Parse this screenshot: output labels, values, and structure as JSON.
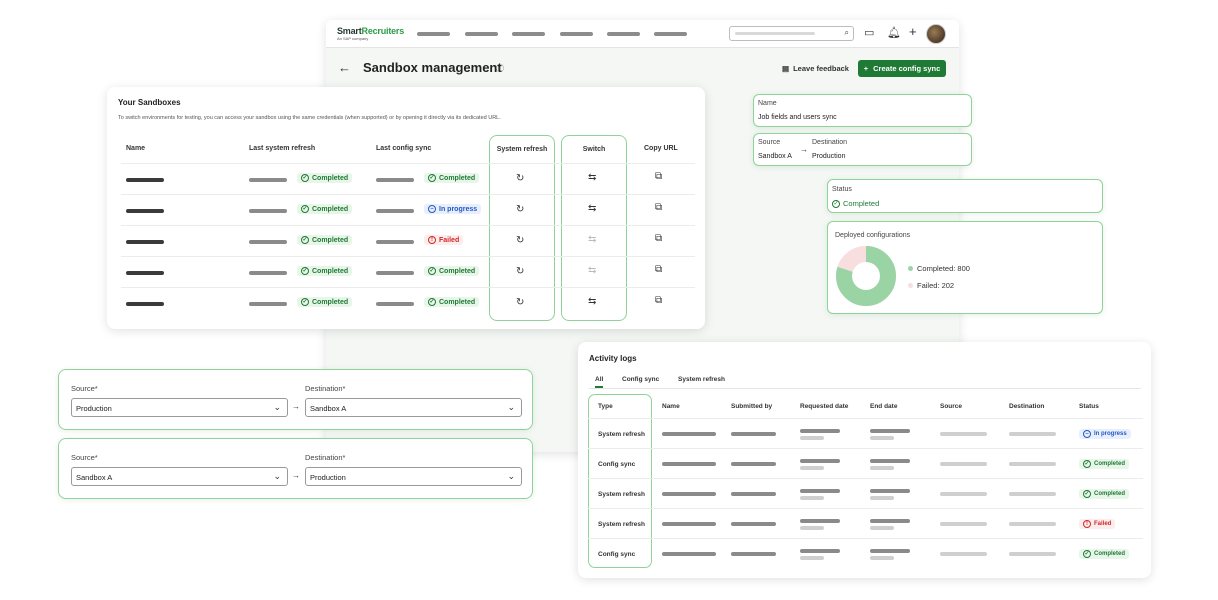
{
  "app": {
    "logo_main": "Smart",
    "logo_accent": "Recruiters",
    "logo_sub": "An SAP company",
    "page_title": "Sandbox management",
    "leave_feedback": "Leave feedback",
    "create_button": "Create config sync"
  },
  "sandboxes": {
    "title": "Your Sandboxes",
    "description": "To switch environments for testing, you can access your sandbox using the same credentials (when supported) or by opening it directly via its dedicated URL.",
    "columns": {
      "name": "Name",
      "last_system_refresh": "Last system refresh",
      "last_config_sync": "Last config sync",
      "system_refresh": "System refresh",
      "switch": "Switch",
      "copy_url": "Copy URL"
    },
    "rows": [
      {
        "refresh_status": "Completed",
        "refresh_kind": "ok",
        "sync_status": "Completed",
        "sync_kind": "ok",
        "switch_enabled": true
      },
      {
        "refresh_status": "Completed",
        "refresh_kind": "ok",
        "sync_status": "In progress",
        "sync_kind": "prog",
        "switch_enabled": true
      },
      {
        "refresh_status": "Completed",
        "refresh_kind": "ok",
        "sync_status": "Failed",
        "sync_kind": "fail",
        "switch_enabled": false
      },
      {
        "refresh_status": "Completed",
        "refresh_kind": "ok",
        "sync_status": "Completed",
        "sync_kind": "ok",
        "switch_enabled": false
      },
      {
        "refresh_status": "Completed",
        "refresh_kind": "ok",
        "sync_status": "Completed",
        "sync_kind": "ok",
        "switch_enabled": true
      }
    ]
  },
  "sync_detail": {
    "name_label": "Name",
    "name_value": "Job fields and users sync",
    "source_label": "Source",
    "source_value": "Sandbox A",
    "destination_label": "Destination",
    "destination_value": "Production"
  },
  "status_card": {
    "label": "Status",
    "value": "Completed"
  },
  "deployed": {
    "title": "Deployed configurations",
    "legend_completed": "Completed: 800",
    "legend_failed": "Failed: 202",
    "completed": 800,
    "failed": 202,
    "color_completed": "#9bd4a4",
    "color_failed": "#f8dede"
  },
  "forms": [
    {
      "source_label": "Source*",
      "source_value": "Production",
      "destination_label": "Destination*",
      "destination_value": "Sandbox A"
    },
    {
      "source_label": "Source*",
      "source_value": "Sandbox A",
      "destination_label": "Destination*",
      "destination_value": "Production"
    }
  ],
  "activity": {
    "title": "Activity logs",
    "tabs": [
      "All",
      "Config sync",
      "System refresh"
    ],
    "columns": {
      "type": "Type",
      "name": "Name",
      "submitted_by": "Submitted by",
      "requested_date": "Requested date",
      "end_date": "End date",
      "source": "Source",
      "destination": "Destination",
      "status": "Status"
    },
    "rows": [
      {
        "type": "System refresh",
        "status": "In progress",
        "kind": "prog"
      },
      {
        "type": "Config sync",
        "status": "Completed",
        "kind": "ok"
      },
      {
        "type": "System refresh",
        "status": "Completed",
        "kind": "ok"
      },
      {
        "type": "System refresh",
        "status": "Failed",
        "kind": "fail"
      },
      {
        "type": "Config sync",
        "status": "Completed",
        "kind": "ok"
      }
    ]
  }
}
